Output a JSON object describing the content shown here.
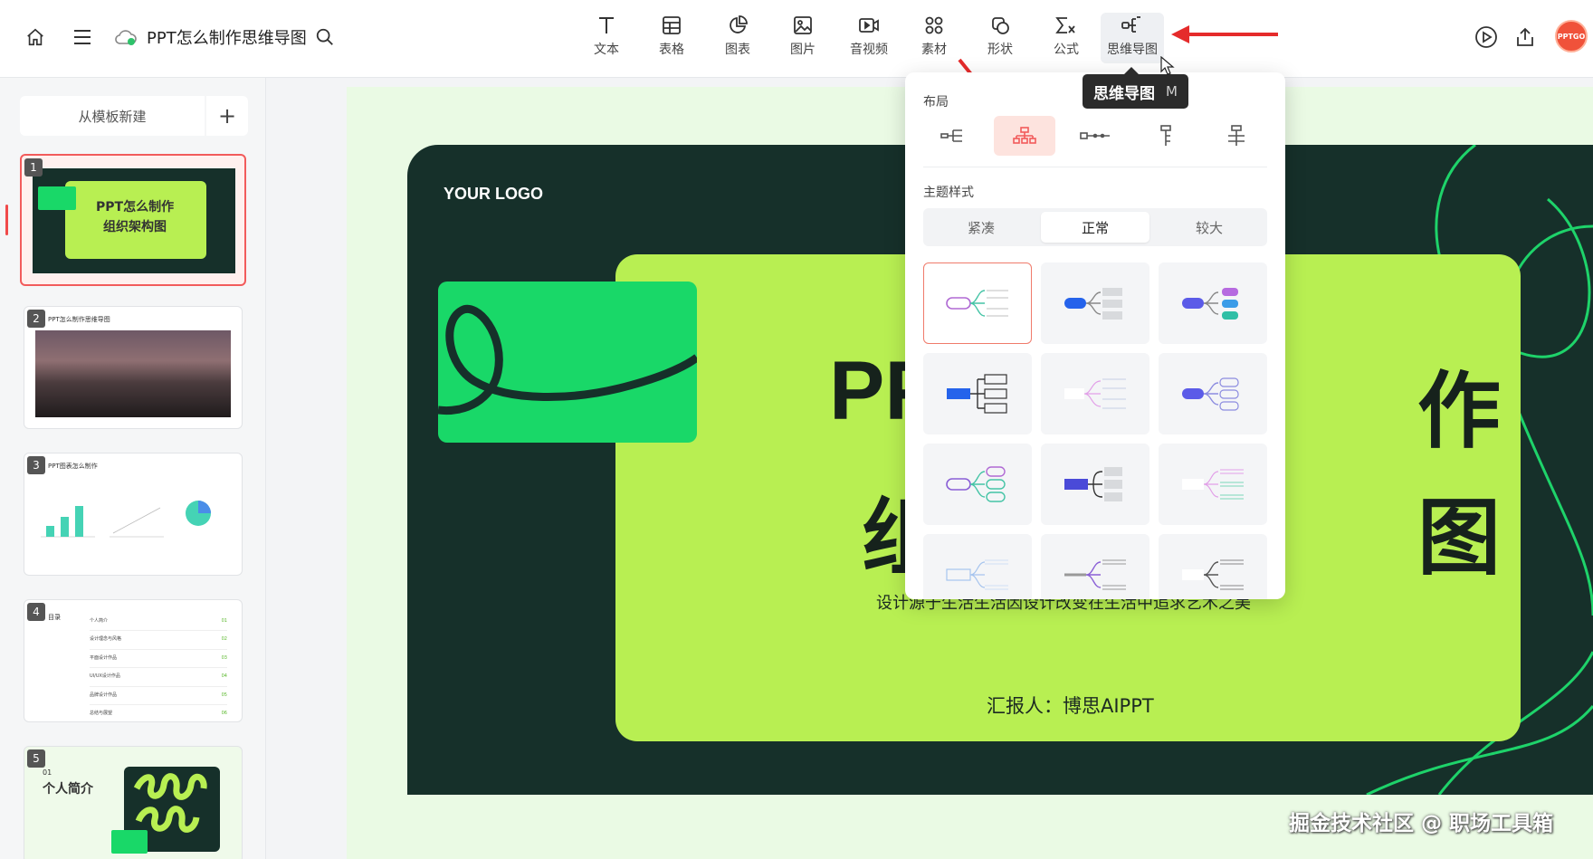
{
  "app": {
    "doc_title": "PPT怎么制作思维导图"
  },
  "toolbar": {
    "tools": [
      {
        "label": "文本",
        "icon": "text-icon"
      },
      {
        "label": "表格",
        "icon": "table-icon"
      },
      {
        "label": "图表",
        "icon": "chart-icon"
      },
      {
        "label": "图片",
        "icon": "image-icon"
      },
      {
        "label": "音视频",
        "icon": "video-icon"
      },
      {
        "label": "素材",
        "icon": "material-icon"
      },
      {
        "label": "形状",
        "icon": "shape-icon"
      },
      {
        "label": "公式",
        "icon": "formula-icon"
      },
      {
        "label": "思维导图",
        "icon": "mindmap-icon"
      }
    ],
    "avatar_text": "PPTGO"
  },
  "tooltip": {
    "label": "思维导图",
    "shortcut": "M"
  },
  "sidebar": {
    "from_template": "从模板新建",
    "add": "+",
    "slides": [
      {
        "num": "1",
        "caption_line1": "PPT怎么制作",
        "caption_line2": "组织架构图"
      },
      {
        "num": "2",
        "caption": "PPT怎么制作思维导图"
      },
      {
        "num": "3",
        "caption": "PPT图表怎么制作"
      },
      {
        "num": "4",
        "caption": "目录",
        "items": [
          "个人简介",
          "设计理念与风格",
          "平面设计作品",
          "UI/UX设计作品",
          "品牌设计作品",
          "总结与展望"
        ],
        "item_numbers": [
          "01",
          "02",
          "03",
          "04",
          "05",
          "06"
        ]
      },
      {
        "num": "5",
        "caption_small": "01",
        "caption": "个人简介"
      }
    ]
  },
  "slide": {
    "logo": "YOUR LOGO",
    "title_left_1": "PP",
    "title_right_1": "作",
    "title_left_2": "组",
    "title_right_2": "图",
    "subtitle": "设计源于生活生活因设计改变在生活中追求艺术之美",
    "reporter": "汇报人：博思AIPPT"
  },
  "dropdown": {
    "layout_label": "布局",
    "layout_selected_index": 1,
    "theme_label": "主题样式",
    "sizes": [
      "紧凑",
      "正常",
      "较大"
    ],
    "size_selected_index": 1,
    "accent": "#f07b6b"
  },
  "watermark": "掘金技术社区 @ 职场工具箱"
}
